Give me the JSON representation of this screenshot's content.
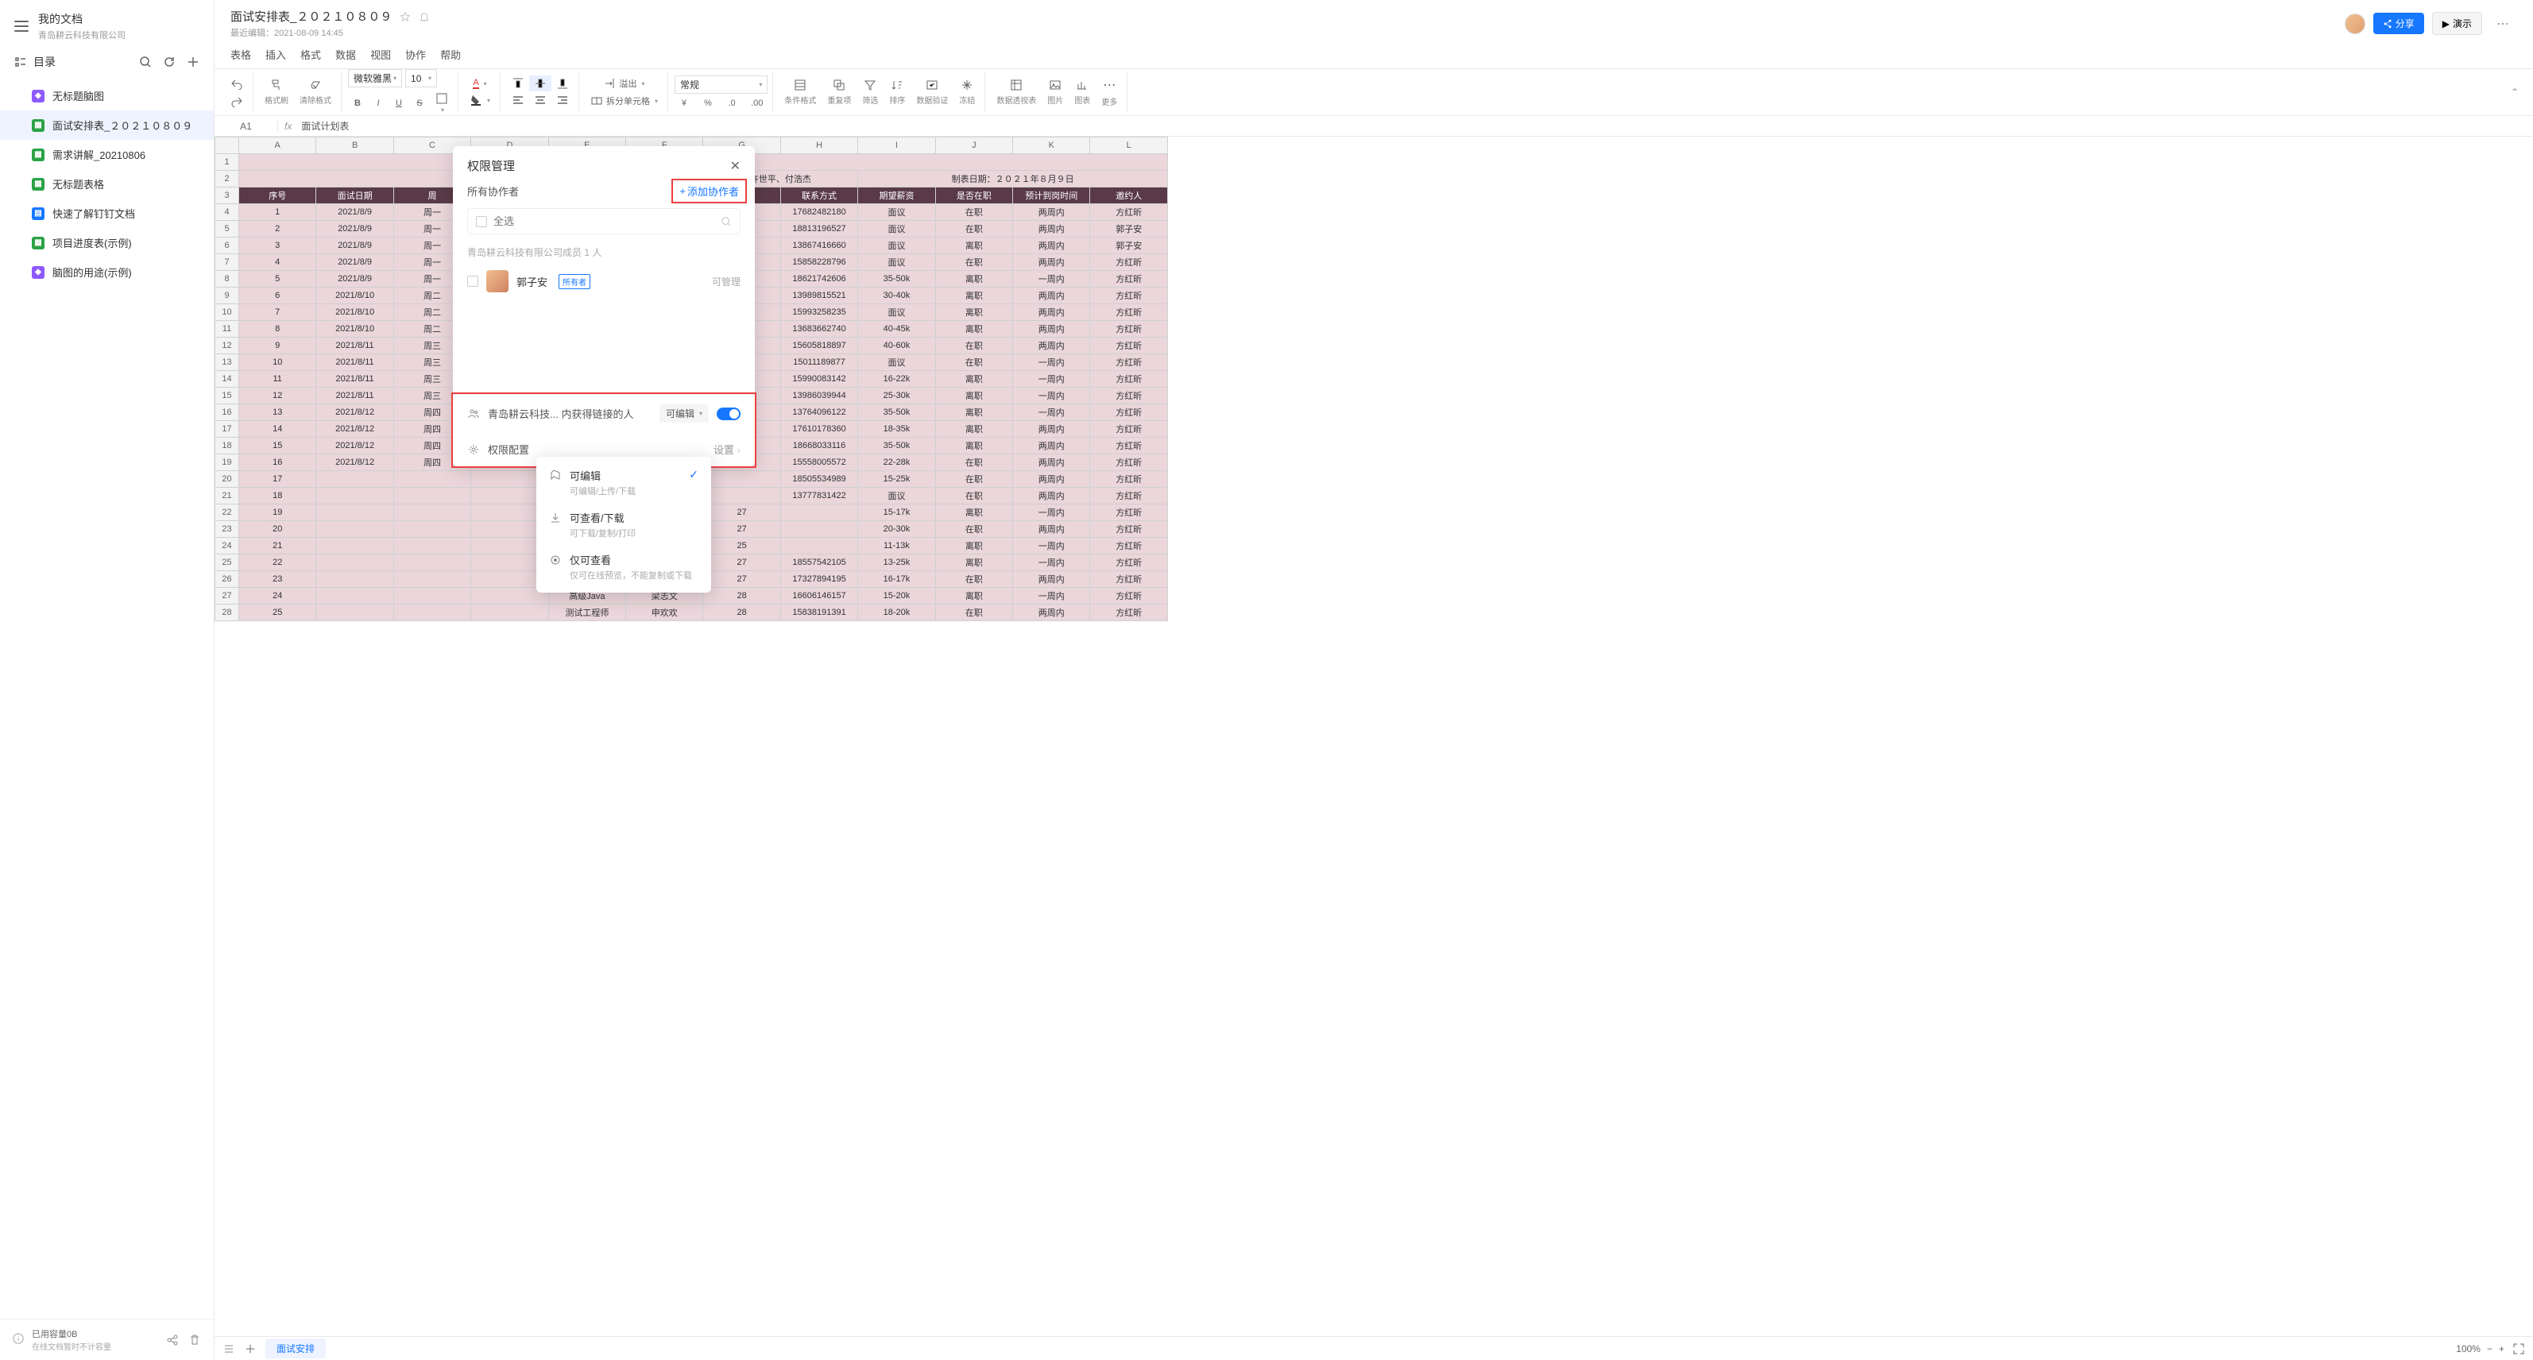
{
  "sidebar": {
    "title": "我的文档",
    "subtitle": "青岛耕云科技有限公司",
    "nav_label": "目录",
    "docs": [
      {
        "icon": "mind",
        "name": "无标题脑图"
      },
      {
        "icon": "sheet",
        "name": "面试安排表_２０２１０８０９",
        "active": true
      },
      {
        "icon": "sheet",
        "name": "需求讲解_20210806"
      },
      {
        "icon": "sheet",
        "name": "无标题表格"
      },
      {
        "icon": "docx",
        "name": "快速了解钉钉文档"
      },
      {
        "icon": "sheet",
        "name": "项目进度表(示例)"
      },
      {
        "icon": "mind",
        "name": "脑图的用途(示例)"
      }
    ],
    "footer_used": "已用容量0B",
    "footer_note": "在线文档暂时不计容量"
  },
  "header": {
    "doc_title": "面试安排表_２０２１０８０９",
    "last_edit": "最近编辑：2021-08-09 14:45",
    "share": "分享",
    "present": "演示"
  },
  "menubar": [
    "表格",
    "插入",
    "格式",
    "数据",
    "视图",
    "协作",
    "帮助"
  ],
  "toolbar": {
    "format_painter": "格式刷",
    "clear_format": "清除格式",
    "font_family": "微软雅黑",
    "font_size": "10",
    "overflow": "溢出",
    "split_cell": "拆分单元格",
    "number_format": "常规",
    "cond_format": "条件格式",
    "dup_check": "重复项",
    "filter": "筛选",
    "sort": "排序",
    "validation": "数据验证",
    "freeze": "冻结",
    "pivot": "数据透视表",
    "image": "图片",
    "chart": "图表",
    "more": "更多"
  },
  "cellbar": {
    "ref": "A1",
    "fx": "fx",
    "value": "面试计划表"
  },
  "sheet": {
    "cols": [
      "A",
      "B",
      "C",
      "D",
      "E",
      "F",
      "G",
      "H",
      "I",
      "J",
      "K",
      "L"
    ],
    "title": "面试计划表",
    "meta_left": "许世平、付浩杰",
    "meta_right": "制表日期：２０２１年８月９日",
    "headers": [
      "序号",
      "面试日期",
      "周",
      "",
      "",
      "",
      "",
      "联系方式",
      "期望薪资",
      "是否在职",
      "预计到岗时间",
      "邀约人"
    ],
    "rows": [
      [
        "1",
        "2021/8/9",
        "周一",
        "",
        "",
        "",
        "",
        "17682482180",
        "面议",
        "在职",
        "两周内",
        "方红昕"
      ],
      [
        "2",
        "2021/8/9",
        "周一",
        "",
        "",
        "",
        "",
        "18813196527",
        "面议",
        "在职",
        "两周内",
        "郭子安"
      ],
      [
        "3",
        "2021/8/9",
        "周一",
        "",
        "",
        "",
        "",
        "13867416660",
        "面议",
        "离职",
        "两周内",
        "郭子安"
      ],
      [
        "4",
        "2021/8/9",
        "周一",
        "",
        "",
        "",
        "",
        "15858228796",
        "面议",
        "在职",
        "两周内",
        "方红昕"
      ],
      [
        "5",
        "2021/8/9",
        "周一",
        "",
        "",
        "",
        "",
        "18621742606",
        "35-50k",
        "离职",
        "一周内",
        "方红昕"
      ],
      [
        "6",
        "2021/8/10",
        "周二",
        "",
        "",
        "",
        "",
        "13989815521",
        "30-40k",
        "离职",
        "两周内",
        "方红昕"
      ],
      [
        "7",
        "2021/8/10",
        "周二",
        "",
        "",
        "",
        "",
        "15993258235",
        "面议",
        "离职",
        "两周内",
        "方红昕"
      ],
      [
        "8",
        "2021/8/10",
        "周二",
        "",
        "",
        "",
        "",
        "13683662740",
        "40-45k",
        "离职",
        "两周内",
        "方红昕"
      ],
      [
        "9",
        "2021/8/11",
        "周三",
        "",
        "",
        "",
        "",
        "15605818897",
        "40-60k",
        "在职",
        "两周内",
        "方红昕"
      ],
      [
        "10",
        "2021/8/11",
        "周三",
        "",
        "",
        "",
        "",
        "15011189877",
        "面议",
        "在职",
        "一周内",
        "方红昕"
      ],
      [
        "11",
        "2021/8/11",
        "周三",
        "",
        "",
        "",
        "",
        "15990083142",
        "16-22k",
        "离职",
        "一周内",
        "方红昕"
      ],
      [
        "12",
        "2021/8/11",
        "周三",
        "",
        "",
        "",
        "",
        "13986039944",
        "25-30k",
        "离职",
        "一周内",
        "方红昕"
      ],
      [
        "13",
        "2021/8/12",
        "周四",
        "",
        "",
        "",
        "",
        "13764096122",
        "35-50k",
        "离职",
        "一周内",
        "方红昕"
      ],
      [
        "14",
        "2021/8/12",
        "周四",
        "",
        "",
        "",
        "",
        "17610178360",
        "18-35k",
        "离职",
        "两周内",
        "方红昕"
      ],
      [
        "15",
        "2021/8/12",
        "周四",
        "",
        "",
        "",
        "",
        "18668033116",
        "35-50k",
        "离职",
        "两周内",
        "方红昕"
      ],
      [
        "16",
        "2021/8/12",
        "周四",
        "",
        "",
        "",
        "",
        "15558005572",
        "22-28k",
        "在职",
        "两周内",
        "方红昕"
      ],
      [
        "17",
        "",
        "",
        "",
        "",
        "",
        "",
        "18505534989",
        "15-25k",
        "在职",
        "两周内",
        "方红昕"
      ],
      [
        "18",
        "",
        "",
        "",
        "",
        "",
        "",
        "13777831422",
        "面议",
        "在职",
        "两周内",
        "方红昕"
      ],
      [
        "19",
        "",
        "",
        "",
        "",
        "",
        "27",
        "",
        "15-17k",
        "离职",
        "一周内",
        "方红昕"
      ],
      [
        "20",
        "",
        "",
        "",
        "",
        "",
        "27",
        "",
        "20-30k",
        "在职",
        "两周内",
        "方红昕"
      ],
      [
        "21",
        "",
        "",
        "",
        "",
        "",
        "25",
        "",
        "11-13k",
        "离职",
        "一周内",
        "方红昕"
      ],
      [
        "22",
        "",
        "",
        "",
        "",
        "",
        "27",
        "18557542105",
        "13-25k",
        "离职",
        "一周内",
        "方红昕"
      ],
      [
        "23",
        "",
        "",
        "",
        "",
        "",
        "27",
        "17327894195",
        "16-17k",
        "在职",
        "两周内",
        "方红昕"
      ],
      [
        "24",
        "",
        "",
        "",
        "高级Java",
        "梁志文",
        "28",
        "16606146157",
        "15-20k",
        "离职",
        "一周内",
        "方红昕"
      ],
      [
        "25",
        "",
        "",
        "",
        "测试工程师",
        "申欢欢",
        "28",
        "15838191391",
        "18-20k",
        "在职",
        "两周内",
        "方红昕"
      ]
    ]
  },
  "bottombar": {
    "tab": "面试安排",
    "zoom": "100%"
  },
  "modal": {
    "title": "权限管理",
    "all_collab": "所有协作者",
    "add_collab": "添加协作者",
    "select_all": "全选",
    "member_hint": "青岛耕云科技有限公司成员 1 人",
    "member_name": "郭子安",
    "owner_tag": "所有者",
    "member_perm": "可管理",
    "link_scope": "青岛耕云科技... 内获得链接的人",
    "link_perm": "可编辑",
    "perm_config": "权限配置",
    "perm_settings": "设置"
  },
  "dropdown": {
    "items": [
      {
        "title": "可编辑",
        "sub": "可编辑/上传/下载",
        "checked": true
      },
      {
        "title": "可查看/下载",
        "sub": "可下载/复制/打印"
      },
      {
        "title": "仅可查看",
        "sub": "仅可在线预览，不能复制或下载"
      }
    ]
  }
}
